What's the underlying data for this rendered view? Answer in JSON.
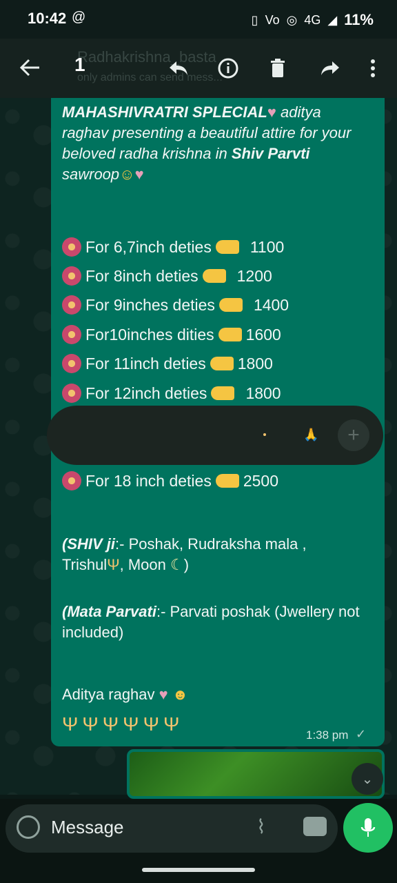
{
  "status": {
    "time": "10:42",
    "network": "4G",
    "battery": "11%"
  },
  "appbar": {
    "selected_count": "1",
    "ghost_title": "Radhakrishna_basta",
    "ghost_subtitle": "only admins can send mess..."
  },
  "message": {
    "header_bold": "MAHASHIVRATRI SPLECIAL",
    "header_rest": " aditya raghav presenting a beautiful attire for your beloved radha krishna in ",
    "header_shiv": "Shiv Parvti",
    "header_end": " sawroop",
    "prices": [
      {
        "label": "For 6,7inch deties",
        "price": "1100"
      },
      {
        "label": "For 8inch deties",
        "price": "1200"
      },
      {
        "label": "For 9inches deties",
        "price": "1400"
      },
      {
        "label": "For10inches dities",
        "price": "1600"
      },
      {
        "label": "For 11inch deties ",
        "price": "1800"
      },
      {
        "label": "For 12inch deties",
        "price": "1800"
      },
      {
        "label": "For 18 inch deties",
        "price": "2500"
      }
    ],
    "shiv_label": "(SHIV ji",
    "shiv_text": ":- Poshak, Rudraksha mala , Trishul",
    "shiv_moon": ", Moon ",
    "parvati_label": "(Mata Parvati",
    "parvati_text": ":- Parvati poshak (Jwellery not included)",
    "signature": "Aditya raghav",
    "time": "1:38 pm"
  },
  "input": {
    "placeholder": "Message"
  }
}
